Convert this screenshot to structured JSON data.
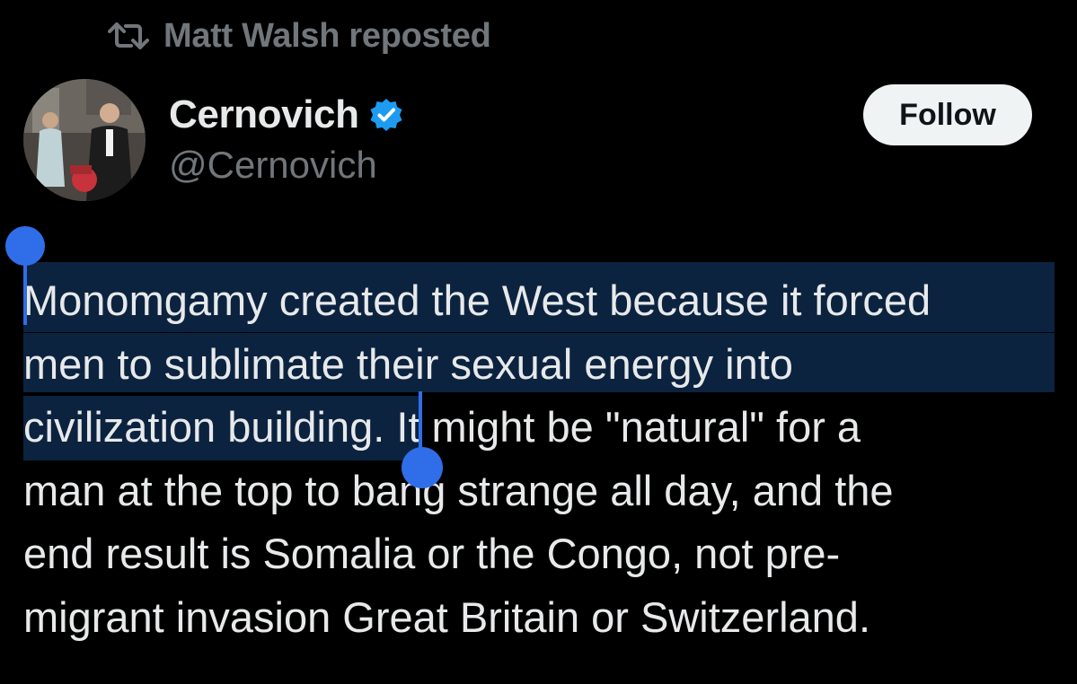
{
  "repost": {
    "icon": "repost-icon",
    "label": "Matt Walsh reposted"
  },
  "author": {
    "avatar_icon": "avatar-photo",
    "name": "Cernovich",
    "verified_icon": "verified-badge-icon",
    "verified_color": "#1d9bf0",
    "handle": "@Cernovich"
  },
  "follow_button": {
    "label": "Follow"
  },
  "tweet": {
    "lines": [
      "Monomgamy created the West because it forced",
      "men to sublimate their sexual energy into",
      "civilization building. It might be \"natural\" for a",
      "man at the top to bang strange all day, and the",
      "end result is Somalia or the Congo, not pre-",
      "migrant invasion Great Britain or Switzerland."
    ]
  },
  "colors": {
    "background": "#000000",
    "text": "#e7e9ea",
    "secondary_text": "#71767b",
    "selection_highlight": "#0c2340",
    "selection_handle": "#2f6ee8"
  }
}
